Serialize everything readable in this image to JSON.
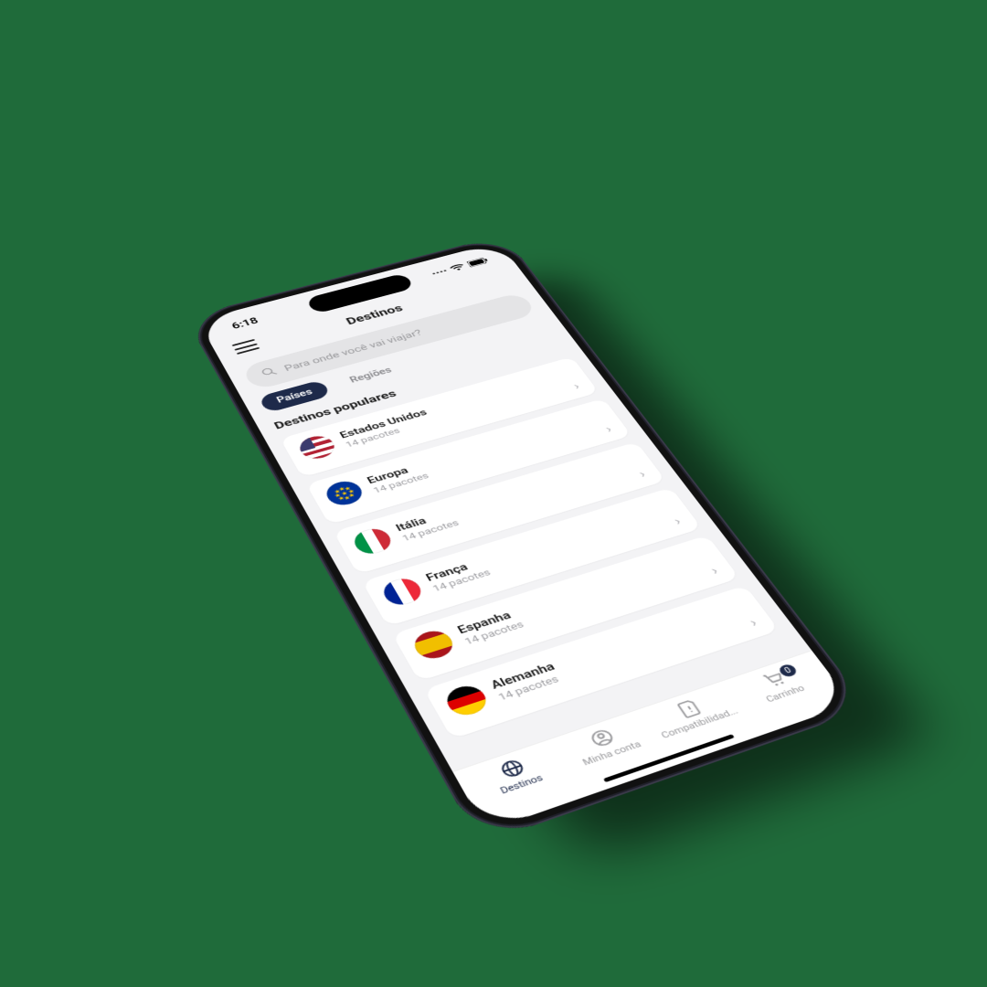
{
  "status": {
    "time": "6:18"
  },
  "header": {
    "title": "Destinos"
  },
  "search": {
    "placeholder": "Para onde você vai viajar?"
  },
  "tabs": {
    "countries": "Países",
    "regions": "Regiões"
  },
  "section": {
    "popular": "Destinos populares"
  },
  "destinations": [
    {
      "name": "Estados Unidos",
      "sub": "14 pacotes",
      "flag": "us"
    },
    {
      "name": "Europa",
      "sub": "14 pacotes",
      "flag": "eu"
    },
    {
      "name": "Itália",
      "sub": "14 pacotes",
      "flag": "it"
    },
    {
      "name": "França",
      "sub": "14 pacotes",
      "flag": "fr"
    },
    {
      "name": "Espanha",
      "sub": "14 pacotes",
      "flag": "es"
    },
    {
      "name": "Alemanha",
      "sub": "14 pacotes",
      "flag": "de"
    }
  ],
  "nav": {
    "destinos": "Destinos",
    "conta": "Minha conta",
    "compat": "Compatibilidad...",
    "carrinho": "Carrinho",
    "cart_count": "0"
  }
}
